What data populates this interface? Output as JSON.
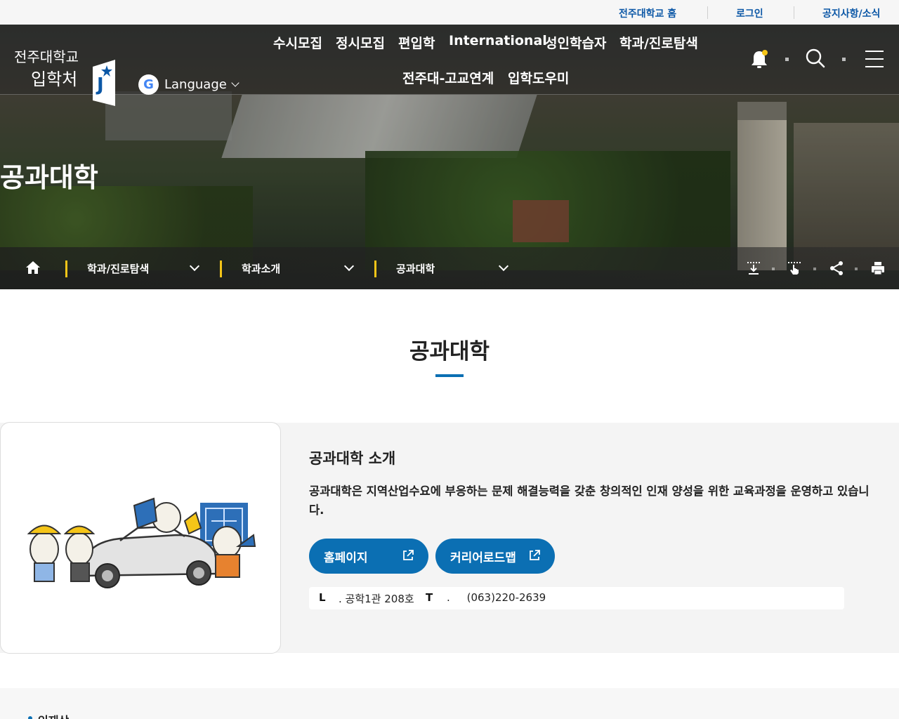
{
  "util_bar": {
    "home_link": "전주대학교 홈",
    "login_link": "로그인",
    "notice_link": "공지사항/소식"
  },
  "header": {
    "logo_line1": "전주대학교",
    "logo_line2": "입학처",
    "language_label": "Language",
    "nav": [
      "수시모집",
      "정시모집",
      "편입학",
      "International",
      "성인학습자",
      "학과/진로탐색",
      "전주대-고교연계",
      "입학도우미"
    ],
    "icons": [
      "bell-icon",
      "search-icon",
      "menu-icon"
    ]
  },
  "hero": {
    "title": "공과대학"
  },
  "breadcrumb": {
    "home_icon": "home-icon",
    "level1": "학과/진로탐색",
    "level2": "학과소개",
    "level3": "공과대학",
    "tools": [
      "download-icon",
      "touch-icon",
      "share-icon",
      "print-icon"
    ]
  },
  "section": {
    "title": "공과대학"
  },
  "intro": {
    "heading": "공과대학 소개",
    "description": "공과대학은 지역산업수요에 부응하는 문제 해결능력을 갖춘 창의적인 인재 양성을 위한 교육과정을 운영하고 있습니다.",
    "homepage_button": "홈페이지",
    "roadmap_button": "커리어로드맵",
    "location_key": "L",
    "location_value": ". 공학1관 208호",
    "tel_key": "T",
    "tel_value": ".     (063)220-2639"
  },
  "bottom": {
    "label": "인재상"
  },
  "colors": {
    "accent": "#0b6fb3",
    "link": "#0b57a6",
    "breadcrumb_separator": "#f5c518"
  }
}
